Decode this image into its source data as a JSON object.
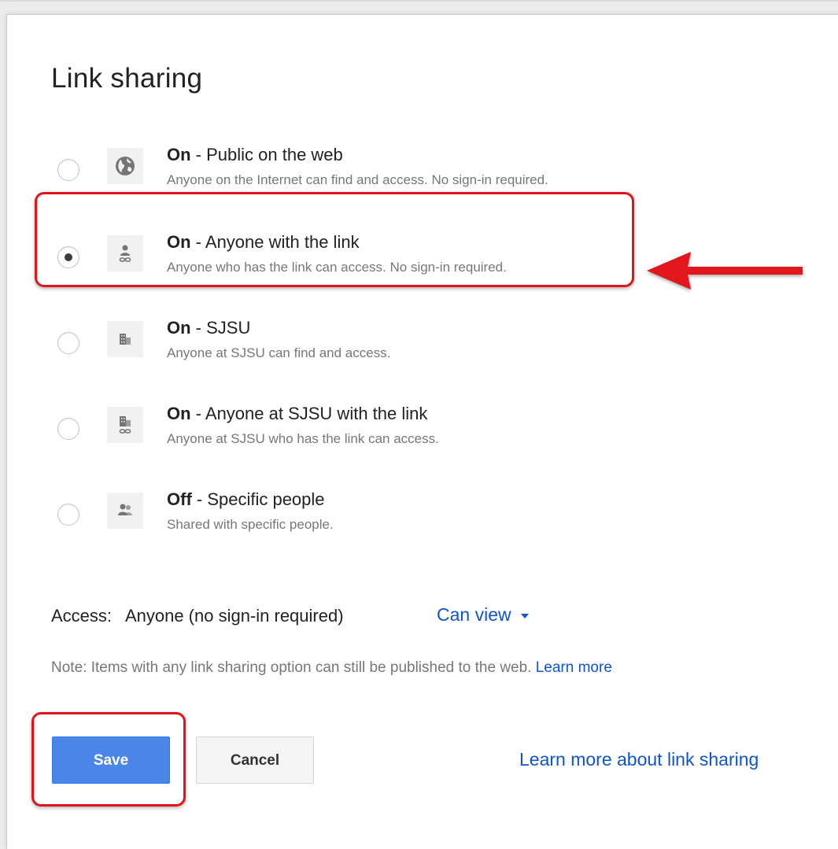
{
  "dialog": {
    "title": "Link sharing"
  },
  "options": [
    {
      "status": "On",
      "title": " - Public on the web",
      "description": "Anyone on the Internet can find and access. No sign-in required.",
      "icon": "globe-icon",
      "selected": false
    },
    {
      "status": "On",
      "title": " - Anyone with the link",
      "description": "Anyone who has the link can access. No sign-in required.",
      "icon": "person-link-icon",
      "selected": true
    },
    {
      "status": "On",
      "title": " - SJSU",
      "description": "Anyone at SJSU can find and access.",
      "icon": "building-icon",
      "selected": false
    },
    {
      "status": "On",
      "title": " - Anyone at SJSU with the link",
      "description": "Anyone at SJSU who has the link can access.",
      "icon": "building-link-icon",
      "selected": false
    },
    {
      "status": "Off",
      "title": " - Specific people",
      "description": "Shared with specific people.",
      "icon": "people-icon",
      "selected": false
    }
  ],
  "access": {
    "label": "Access:",
    "value": "Anyone (no sign-in required)",
    "permission": "Can view"
  },
  "note": {
    "text": "Note: Items with any link sharing option can still be published to the web. ",
    "link": "Learn more"
  },
  "buttons": {
    "save": "Save",
    "cancel": "Cancel"
  },
  "footer_link": "Learn more about link sharing",
  "colors": {
    "accent_blue": "#4a86e8",
    "link_blue": "#1155cc",
    "highlight_red": "#e2141b"
  }
}
